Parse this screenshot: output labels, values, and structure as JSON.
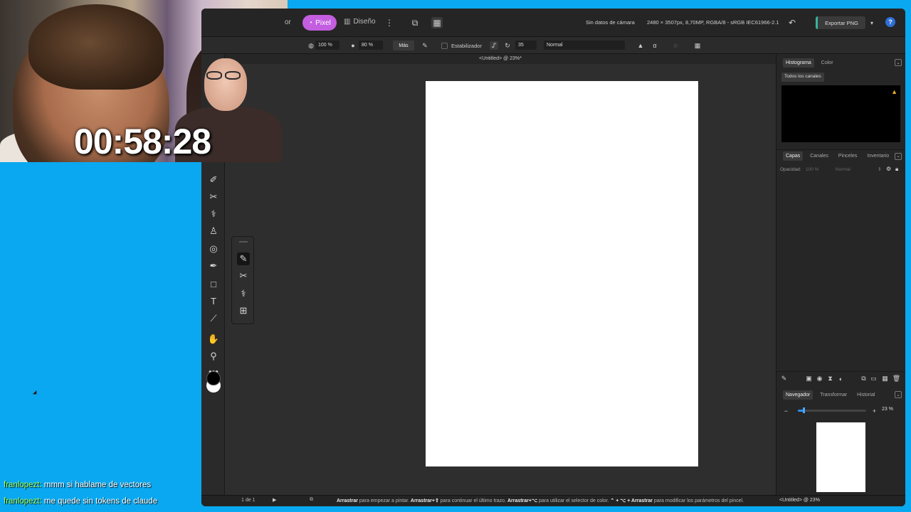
{
  "overlay": {
    "timer": "00:58:28"
  },
  "app": {
    "tabs": {
      "partial_tab": "or",
      "pixel_label": "Pixel",
      "design_label": "Diseño"
    },
    "topbar": {
      "camera_info": "Sin datos de cámara",
      "document_info": "2480 × 3507px, 8,70MP, RGBA/8 - sRGB IEC61966-2.1",
      "export_label": "Exportar PNG",
      "help_label": "?"
    },
    "context": {
      "opacity": "100 %",
      "flow": "80 %",
      "more_label": "Más",
      "stabilizer_label": "Estabilizador",
      "stabilizer_value": "35",
      "blend_mode": "Normal"
    },
    "document_title": "<Untitled> @ 23%*",
    "histogram_panel": {
      "tabs": [
        "Histograma",
        "Color"
      ],
      "active": 0,
      "channel_select": "Todos los canales"
    },
    "layers_panel": {
      "tabs": [
        "Capas",
        "Canales",
        "Pinceles",
        "Inventario"
      ],
      "active": 0,
      "opacity_label": "Opacidad:",
      "opacity_value": "100 %",
      "blend_mode": "Normal"
    },
    "navigator_panel": {
      "tabs": [
        "Navegador",
        "Transformar",
        "Historial"
      ],
      "active": 0,
      "zoom_value": "23 %",
      "zoom_fraction": 0.08
    },
    "status": {
      "page_indicator": "1 de 1",
      "hint_parts": [
        {
          "bold": "Arrastrar",
          "text": " para empezar a pintar. "
        },
        {
          "bold": "Arrastrar+⇧",
          "text": " para continuar el último trazo. "
        },
        {
          "bold": "Arrastrar+⌥",
          "text": " para utilizar el selector de color. "
        },
        {
          "bold": "⌃ + ⌥ + Arrastrar",
          "text": " para modificar los parámetros del pincel."
        }
      ],
      "right_title": "<Untitled> @ 23%"
    },
    "tools": [
      "eraser-icon",
      "smudge-icon",
      "healing-icon",
      "stamp-icon",
      "selection-brush-icon",
      "pen-icon",
      "rectangle-icon",
      "text-icon",
      "eyedropper-icon",
      "hand-icon",
      "zoom-icon",
      "more-icon"
    ],
    "colors": {
      "accent_pixel": "#c35ee0",
      "export_accent": "#38b4a0",
      "help": "#2f6fd6",
      "primary_color": "#000000",
      "secondary_color": "#ffffff"
    }
  },
  "chat": [
    {
      "user": "franlopezt:",
      "message": "mmm si hablame de vectores"
    },
    {
      "user": "franlopezt:",
      "message": "me quede sin tokens de claude"
    }
  ]
}
